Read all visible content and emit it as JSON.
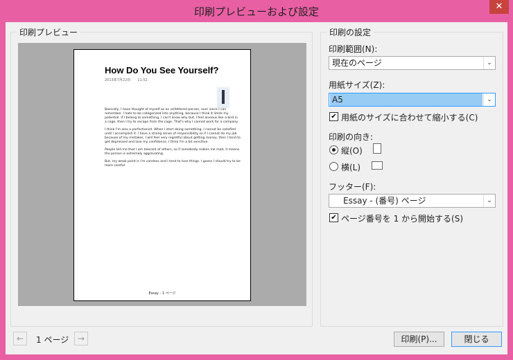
{
  "window": {
    "title": "印刷プレビューおよび設定",
    "close_glyph": "✕"
  },
  "preview_group": {
    "title": "印刷プレビュー"
  },
  "document": {
    "title": "How Do You See Yourself?",
    "date": "2013年7月22日　　11:52",
    "paragraphs": [
      "Basically, I have thought of myself as an unfettered person, ever since I can remember. I hate to be categorized into anything, because I think it limits my potential. If I belong to something, I can't know why but, I feel anxious like a bird in a cage, then I try to escape from the cage. That's why I cannot work for a company.",
      "I think I'm also a perfectionist. When I start doing something, I cannot be satisfied until I accomplish it. I have a strong sense of responsibility so if I cannot do my job because of my mistakes, I will feel very regretful about getting money, then I tend to get depressed and lose my confidence. I think I'm a bit sensitive.",
      "People tell me that I am tolerant of others, so if somebody makes me mad, it means the person is extremely aggravating.",
      "But, my weak point is I'm careless and I tend to lose things. I guess I should try to be more careful."
    ],
    "footer": "Essay - 1 ページ"
  },
  "settings_group": {
    "title": "印刷の設定"
  },
  "print_range": {
    "label": "印刷範囲(N):",
    "value": "現在のページ"
  },
  "paper_size": {
    "label": "用紙サイズ(Z):",
    "value": "A5"
  },
  "shrink_to_fit": {
    "label": "用紙のサイズに合わせて縮小する(C)",
    "checked": true
  },
  "orientation": {
    "label": "印刷の向き:",
    "portrait_label": "縦(O)",
    "landscape_label": "横(L)",
    "selected": "portrait"
  },
  "footer_setting": {
    "label": "フッター(F):",
    "value": "Essay - (番号) ページ"
  },
  "start_page_one": {
    "label": "ページ番号を 1 から開始する(S)",
    "checked": true
  },
  "navigation": {
    "prev_glyph": "←",
    "next_glyph": "→",
    "page_text": "1 ページ"
  },
  "buttons": {
    "print": "印刷(P)...",
    "close": "閉じる"
  },
  "check_glyph": "✔",
  "dropdown_glyph": "⌄"
}
